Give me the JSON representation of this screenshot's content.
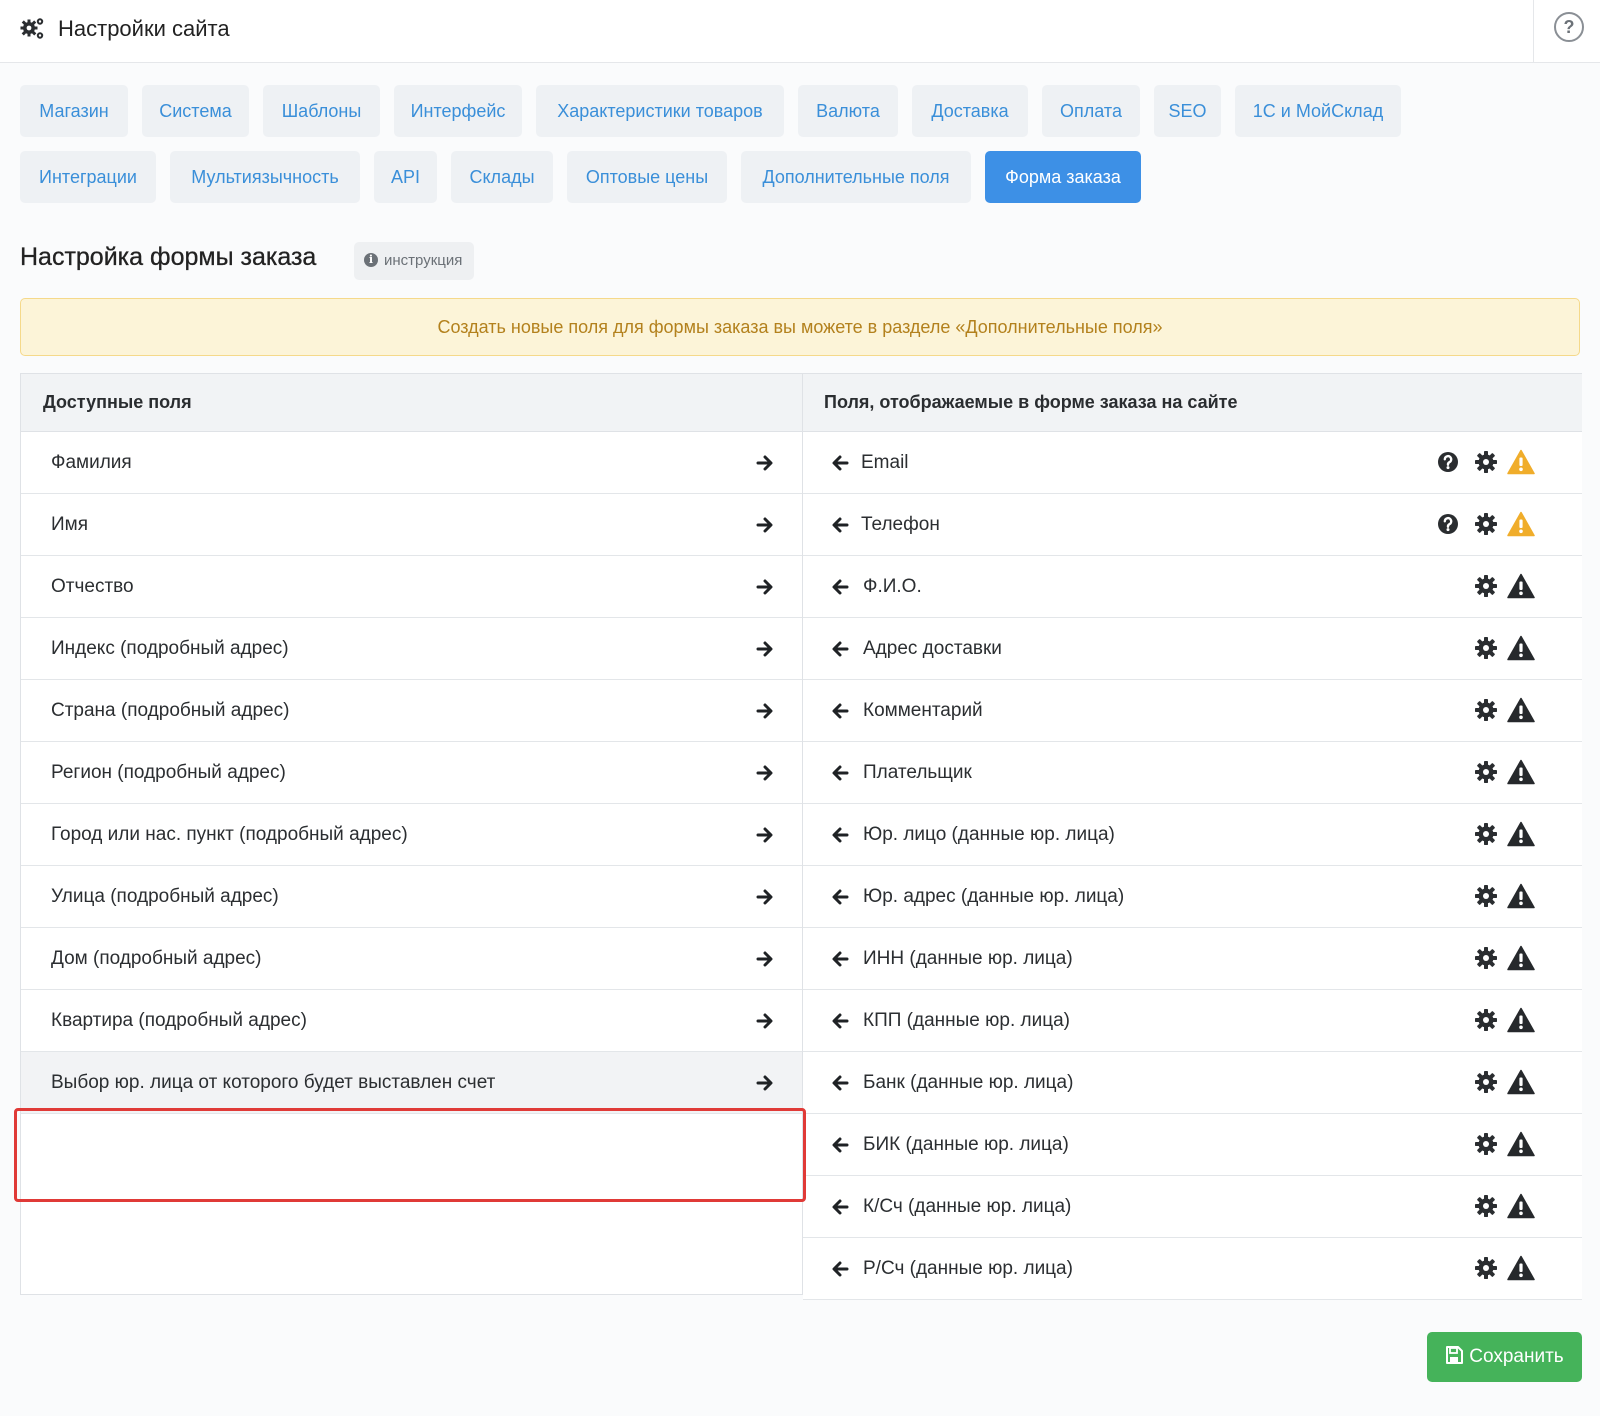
{
  "header": {
    "title": "Настройки сайта",
    "help_symbol": "?"
  },
  "tabs": [
    {
      "label": "Магазин",
      "active": false
    },
    {
      "label": "Система",
      "active": false
    },
    {
      "label": "Шаблоны",
      "active": false
    },
    {
      "label": "Интерфейс",
      "active": false
    },
    {
      "label": "Характеристики товаров",
      "active": false
    },
    {
      "label": "Валюта",
      "active": false
    },
    {
      "label": "Доставка",
      "active": false
    },
    {
      "label": "Оплата",
      "active": false
    },
    {
      "label": "SEO",
      "active": false
    },
    {
      "label": "1С и МойСклад",
      "active": false
    },
    {
      "label": "Интеграции",
      "active": false
    },
    {
      "label": "Мультиязычность",
      "active": false
    },
    {
      "label": "API",
      "active": false
    },
    {
      "label": "Склады",
      "active": false
    },
    {
      "label": "Оптовые цены",
      "active": false
    },
    {
      "label": "Дополнительные поля",
      "active": false
    },
    {
      "label": "Форма заказа",
      "active": true
    }
  ],
  "section": {
    "title": "Настройка формы заказа",
    "instruction_label": "инструкция",
    "instruction_icon": "i"
  },
  "alert": {
    "text": "Создать новые поля для формы заказа вы можете в разделе «Дополнительные поля»"
  },
  "available": {
    "header": "Доступные поля",
    "items": [
      "Фамилия",
      "Имя",
      "Отчество",
      "Индекс (подробный адрес)",
      "Страна (подробный адрес)",
      "Регион (подробный адрес)",
      "Город или нас. пункт (подробный адрес)",
      "Улица (подробный адрес)",
      "Дом (подробный адрес)",
      "Квартира (подробный адрес)",
      "Выбор юр. лица от которого будет выставлен счет"
    ],
    "selected_index": 10
  },
  "displayed": {
    "header": "Поля, отображаемые в форме заказа на сайте",
    "items": [
      {
        "label": "Email",
        "help": true,
        "warning_color": "#f0ad2b"
      },
      {
        "label": "Телефон",
        "help": true,
        "warning_color": "#f0ad2b"
      },
      {
        "label": "Ф.И.О.",
        "help": false,
        "warning_color": "#26292c"
      },
      {
        "label": "Адрес доставки",
        "help": false,
        "warning_color": "#26292c"
      },
      {
        "label": "Комментарий",
        "help": false,
        "warning_color": "#26292c"
      },
      {
        "label": "Плательщик",
        "help": false,
        "warning_color": "#26292c"
      },
      {
        "label": "Юр. лицо (данные юр. лица)",
        "help": false,
        "warning_color": "#26292c"
      },
      {
        "label": "Юр. адрес (данные юр. лица)",
        "help": false,
        "warning_color": "#26292c"
      },
      {
        "label": "ИНН (данные юр. лица)",
        "help": false,
        "warning_color": "#26292c"
      },
      {
        "label": "КПП (данные юр. лица)",
        "help": false,
        "warning_color": "#26292c"
      },
      {
        "label": "Банк (данные юр. лица)",
        "help": false,
        "warning_color": "#26292c"
      },
      {
        "label": "БИК (данные юр. лица)",
        "help": false,
        "warning_color": "#26292c"
      },
      {
        "label": "К/Сч (данные юр. лица)",
        "help": false,
        "warning_color": "#26292c"
      },
      {
        "label": "Р/Сч (данные юр. лица)",
        "help": false,
        "warning_color": "#26292c"
      }
    ]
  },
  "save_label": "Сохранить",
  "colors": {
    "accent": "#3d90e6",
    "tab_text": "#3a8fd9",
    "save": "#45b35a",
    "highlight": "#e03a37",
    "alert_bg": "#fcf4d8",
    "alert_text": "#b3811d"
  }
}
